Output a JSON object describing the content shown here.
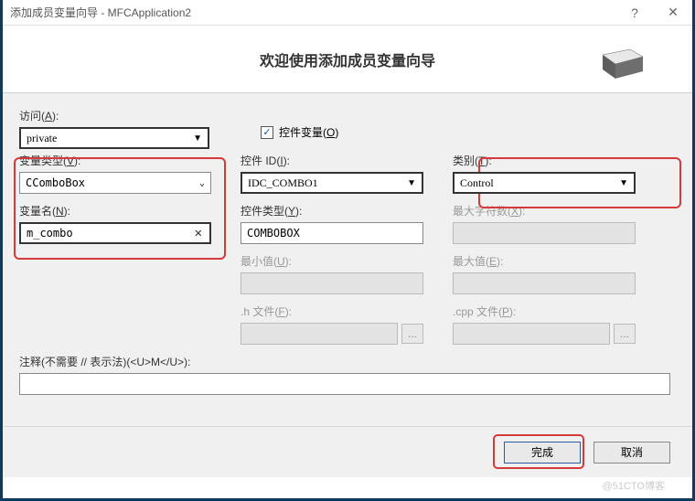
{
  "titlebar": {
    "title": "添加成员变量向导 - MFCApplication2",
    "help": "?",
    "close": "✕"
  },
  "header": {
    "title": "欢迎使用添加成员变量向导"
  },
  "labels": {
    "access": "访问(A):",
    "control_var": "控件变量(O)",
    "var_type": "变量类型(V):",
    "control_id": "控件 ID(I):",
    "category": "类别(T):",
    "var_name": "变量名(N):",
    "control_type": "控件类型(Y):",
    "max_chars": "最大字符数(X):",
    "min_val": "最小值(U):",
    "max_val": "最大值(E):",
    "h_file": ".h 文件(F):",
    "cpp_file": ".cpp 文件(P):",
    "comment": "注释(不需要 // 表示法)(<U>M</U>):"
  },
  "values": {
    "access": "private",
    "var_type": "CComboBox",
    "control_id": "IDC_COMBO1",
    "category": "Control",
    "var_name": "m_combo",
    "control_type": "COMBOBOX",
    "checkbox_checked": "✓"
  },
  "buttons": {
    "finish": "完成",
    "cancel": "取消",
    "dots": "..."
  },
  "watermark": "@51CTO博客"
}
